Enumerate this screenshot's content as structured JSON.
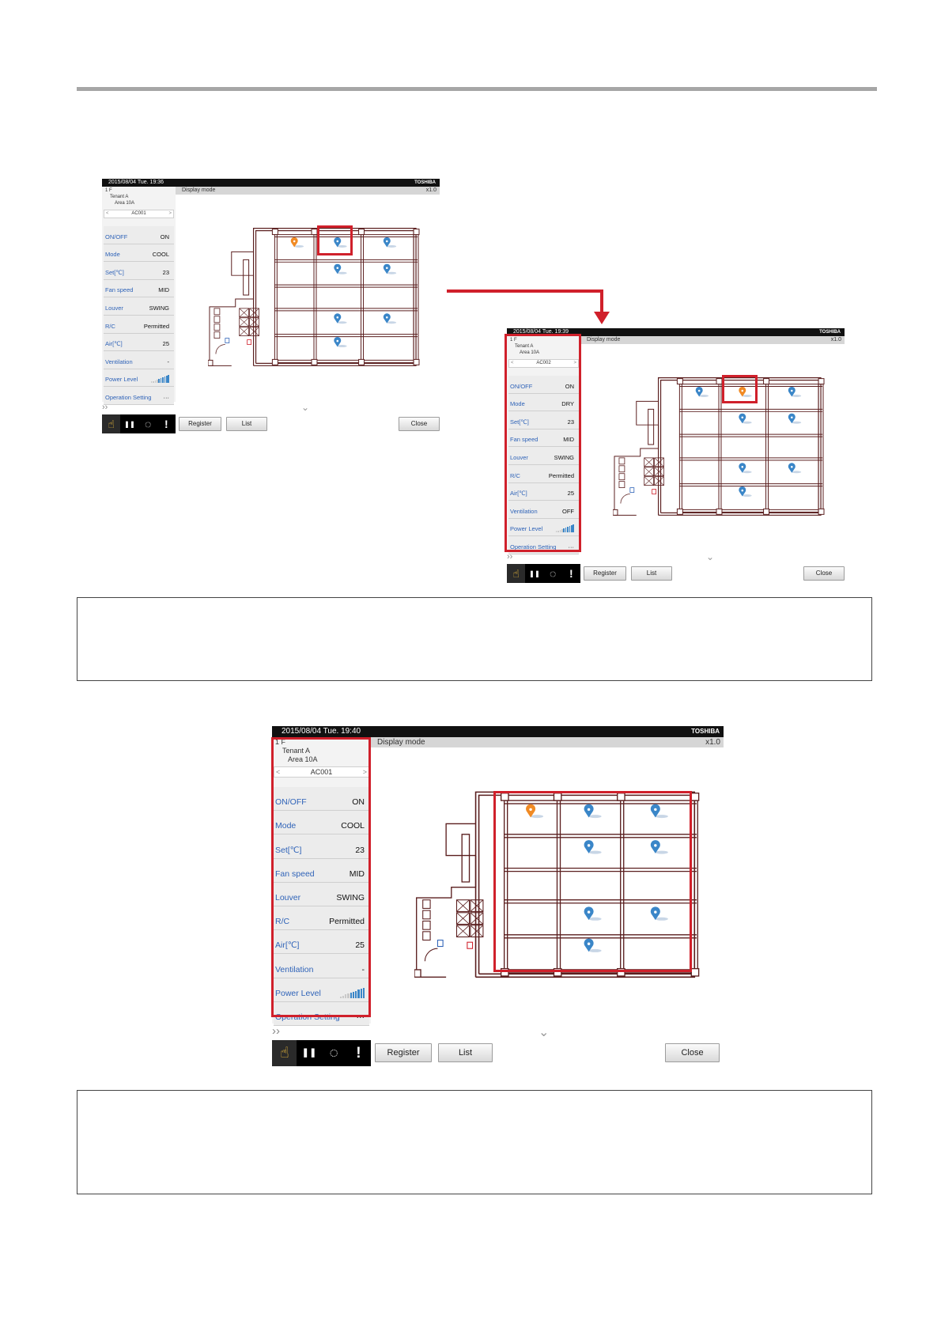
{
  "screens": {
    "screen1": {
      "datetime": "2015/08/04  Tue.  19:36",
      "brand": "TOSHIBA",
      "mode_label": "Display mode",
      "zoom": "x1.0",
      "tree": {
        "floor": "1 F",
        "tenant": "Tenant A",
        "area": "Area 10A"
      },
      "unit": "AC001",
      "params": [
        {
          "label": "ON/OFF",
          "value": "ON"
        },
        {
          "label": "Mode",
          "value": "COOL"
        },
        {
          "label": "Set[℃]",
          "value": "23"
        },
        {
          "label": "Fan speed",
          "value": "MID"
        },
        {
          "label": "Louver",
          "value": "SWING"
        },
        {
          "label": "R/C",
          "value": "Permitted"
        },
        {
          "label": "Air[℃]",
          "value": "25"
        },
        {
          "label": "Ventilation",
          "value": "-"
        },
        {
          "label": "Power Level",
          "value": ""
        },
        {
          "label": "Operation Setting",
          "value": "···"
        }
      ],
      "buttons": {
        "register": "Register",
        "list": "List",
        "close": "Close"
      }
    },
    "screen2": {
      "datetime": "2015/08/04  Tue.  19:39",
      "brand": "TOSHIBA",
      "mode_label": "Display mode",
      "zoom": "x1.0",
      "tree": {
        "floor": "1 F",
        "tenant": "Tenant A",
        "area": "Area 10A"
      },
      "unit": "AC002",
      "params": [
        {
          "label": "ON/OFF",
          "value": "ON"
        },
        {
          "label": "Mode",
          "value": "DRY"
        },
        {
          "label": "Set[℃]",
          "value": "23"
        },
        {
          "label": "Fan speed",
          "value": "MID"
        },
        {
          "label": "Louver",
          "value": "SWING"
        },
        {
          "label": "R/C",
          "value": "Permitted"
        },
        {
          "label": "Air[℃]",
          "value": "25"
        },
        {
          "label": "Ventilation",
          "value": "OFF"
        },
        {
          "label": "Power Level",
          "value": ""
        },
        {
          "label": "Operation Setting",
          "value": "···"
        }
      ],
      "buttons": {
        "register": "Register",
        "list": "List",
        "close": "Close"
      }
    },
    "screen3": {
      "datetime": "2015/08/04  Tue.  19:40",
      "brand": "TOSHIBA",
      "mode_label": "Display mode",
      "zoom": "x1.0",
      "tree": {
        "floor": "1 F",
        "tenant": "Tenant A",
        "area": "Area 10A"
      },
      "unit": "AC001",
      "params": [
        {
          "label": "ON/OFF",
          "value": "ON"
        },
        {
          "label": "Mode",
          "value": "COOL"
        },
        {
          "label": "Set[℃]",
          "value": "23"
        },
        {
          "label": "Fan speed",
          "value": "MID"
        },
        {
          "label": "Louver",
          "value": "SWING"
        },
        {
          "label": "R/C",
          "value": "Permitted"
        },
        {
          "label": "Air[℃]",
          "value": "25"
        },
        {
          "label": "Ventilation",
          "value": "-"
        },
        {
          "label": "Power Level",
          "value": ""
        },
        {
          "label": "Operation Setting",
          "value": "···"
        }
      ],
      "buttons": {
        "register": "Register",
        "list": "List",
        "close": "Close"
      }
    }
  },
  "icons": {
    "tabs": [
      "touch-hand-icon",
      "pause-icon",
      "schedule-icon",
      "alarm-icon"
    ],
    "expander": "double-chevron-right-icon",
    "scroll": "chevron-down-icon",
    "unit_marker": "ac-unit-marker-icon"
  },
  "colors": {
    "highlight": "#d0202b",
    "unit_on": "#f08a24",
    "unit_off": "#3a86c8",
    "label_text": "#2f63b8",
    "plan_lines": "#5a1e1e",
    "top_rule": "#a6a6a6",
    "power_active": "#e8a000"
  },
  "power_level": {
    "filled": 6,
    "total": 10
  }
}
